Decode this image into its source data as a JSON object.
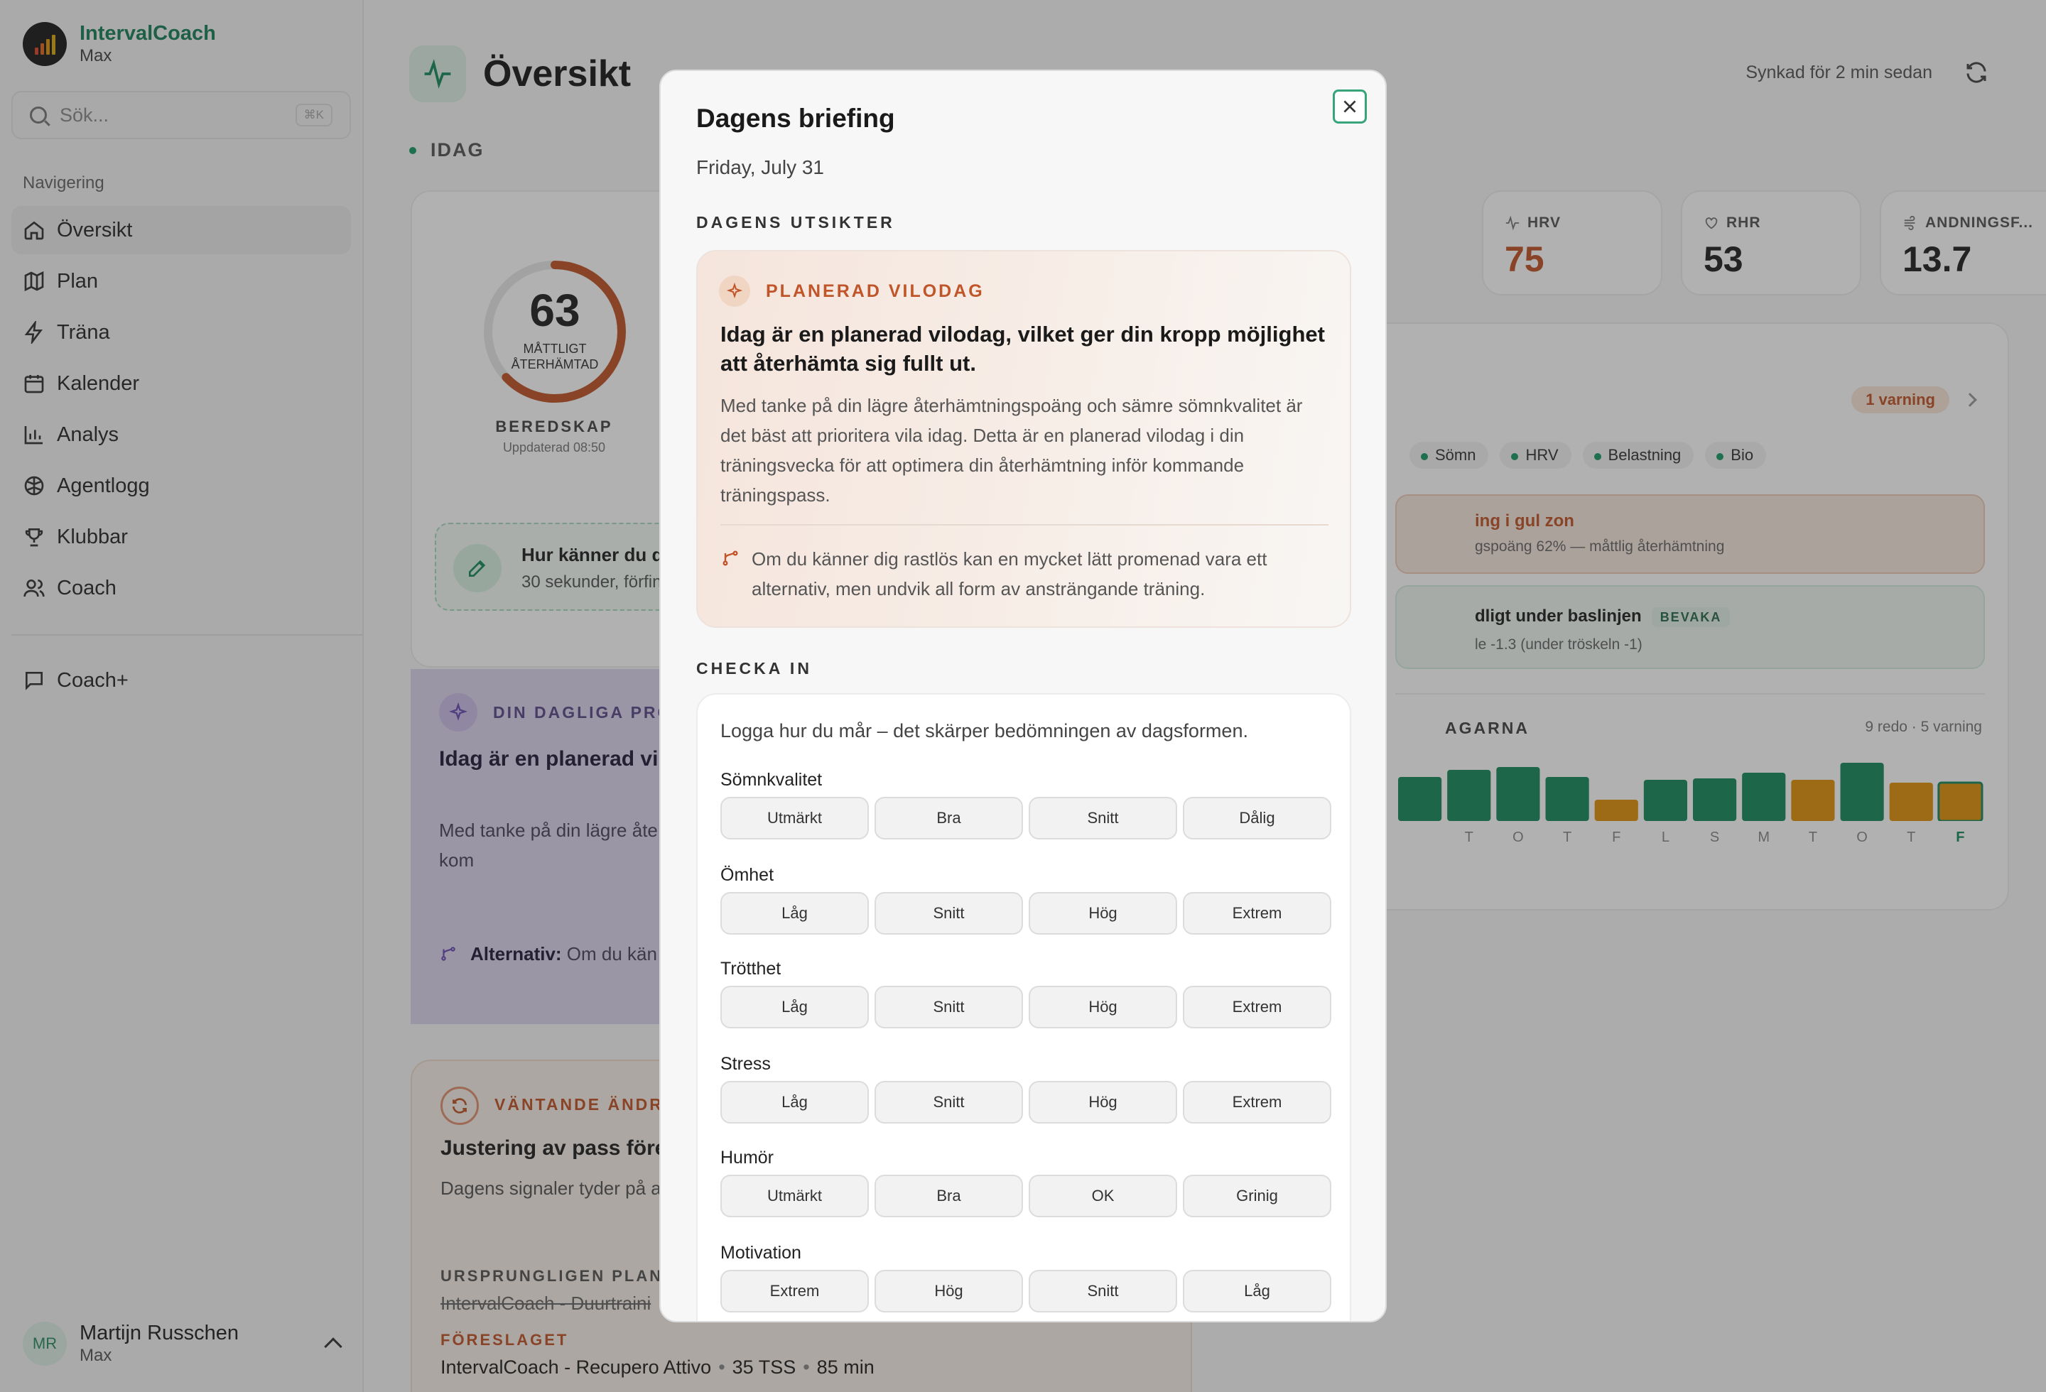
{
  "app": {
    "name": "IntervalCoach",
    "sub": "Max"
  },
  "search": {
    "placeholder": "Sök...",
    "shortcut": "⌘K"
  },
  "nav": {
    "heading": "Navigering",
    "items": [
      {
        "label": "Översikt",
        "icon": "home-icon"
      },
      {
        "label": "Plan",
        "icon": "map-icon"
      },
      {
        "label": "Träna",
        "icon": "lightning-icon"
      },
      {
        "label": "Kalender",
        "icon": "calendar-icon"
      },
      {
        "label": "Analys",
        "icon": "bar-chart-icon"
      },
      {
        "label": "Agentlogg",
        "icon": "brain-icon"
      },
      {
        "label": "Klubbar",
        "icon": "trophy-icon"
      },
      {
        "label": "Coach",
        "icon": "users-icon"
      }
    ],
    "coachplus": "Coach+"
  },
  "user": {
    "initials": "MR",
    "name": "Martijn Russchen",
    "sub": "Max"
  },
  "page": {
    "title": "Översikt",
    "synced": "Synkad för 2 min sedan",
    "today": "IDAG"
  },
  "readiness": {
    "score": "63",
    "score_value": 63,
    "state": "MÅTTLIGT ÅTERHÄMTAD",
    "title": "BEREDSKAP",
    "updated": "Uppdaterad 08:50",
    "feel_title": "Hur känner du d",
    "feel_sub": "30 sekunder, förfin"
  },
  "daily": {
    "label": "DIN DAGLIGA PRO",
    "title": "Idag är en planerad vi återhämta sig fullt ut.",
    "body": "Med tanke på din lägre åte prioritera vila idag. Detta ä din återhämtning inför kom",
    "alt_label": "Alternativ:",
    "alt_text": " Om du kän alternativ, men undvik"
  },
  "pending": {
    "label": "VÄNTANDE ÄNDRI",
    "title": "Justering av pass föres",
    "body": "Dagens signaler tyder på a eller behåll originalet.",
    "orig_label": "URSPRUNGLIGEN PLANER",
    "orig": "IntervalCoach - Duurtraini",
    "new_label": "FÖRESLAGET",
    "new_name": "IntervalCoach - Recupero Attivo",
    "new_tss": "35 TSS",
    "new_min": "85 min",
    "sep": "•"
  },
  "metrics": [
    {
      "label": "HRV",
      "value": "75",
      "color": "#c0552a",
      "icon": "pulse-icon"
    },
    {
      "label": "RHR",
      "value": "53",
      "color": "#222222",
      "icon": "heart-icon"
    },
    {
      "label": "ANDNINGSF...",
      "value": "13.7",
      "color": "#222222",
      "icon": "wind-icon"
    }
  ],
  "signals": {
    "warning": "1 varning",
    "chips": [
      "Sömn",
      "HRV",
      "Belastning",
      "Bio"
    ],
    "alert1_title": "ing i gul zon",
    "alert1_sub": "gspoäng 62% — måttlig återhämtning",
    "alert2_title": "dligt under baslinjen",
    "alert2_badge": "BEVAKA",
    "alert2_sub": "le -1.3 (under tröskeln -1)",
    "days_title": "AGARNA",
    "days_meta": "9 redo · 5 varning"
  },
  "day_bars": [
    {
      "day": "",
      "level": 0.62,
      "status": "green"
    },
    {
      "day": "T",
      "level": 0.72,
      "status": "green"
    },
    {
      "day": "O",
      "level": 0.76,
      "status": "green"
    },
    {
      "day": "T",
      "level": 0.62,
      "status": "green"
    },
    {
      "day": "F",
      "level": 0.3,
      "status": "orange"
    },
    {
      "day": "L",
      "level": 0.58,
      "status": "green"
    },
    {
      "day": "S",
      "level": 0.6,
      "status": "green"
    },
    {
      "day": "M",
      "level": 0.68,
      "status": "green"
    },
    {
      "day": "T",
      "level": 0.58,
      "status": "orange"
    },
    {
      "day": "O",
      "level": 0.82,
      "status": "green"
    },
    {
      "day": "T",
      "level": 0.54,
      "status": "orange"
    },
    {
      "day": "F",
      "level": 0.54,
      "status": "orange-today"
    }
  ],
  "colors": {
    "green": "#1a8a5e",
    "orange": "#e0910e",
    "accent": "#1a7f5a",
    "warn": "#c0552a"
  },
  "modal": {
    "title": "Dagens briefing",
    "date": "Friday, July 31",
    "prospect_section": "DAGENS UTSIKTER",
    "prospect_label": "PLANERAD VILODAG",
    "prospect_title": "Idag är en planerad vilodag, vilket ger din kropp möjlighet att återhämta sig fullt ut.",
    "prospect_body": "Med tanke på din lägre återhämtningspoäng och sämre sömnkvalitet är det bäst att prioritera vila idag. Detta är en planerad vilodag i din träningsvecka för att optimera din återhämtning inför kommande träningspass.",
    "prospect_tip": "Om du känner dig rastlös kan en mycket lätt promenad vara ett alternativ, men undvik all form av ansträngande träning.",
    "checkin_section": "CHECKA IN",
    "checkin_intro": "Logga hur du mår – det skärper bedömningen av dagsformen.",
    "questions": [
      {
        "label": "Sömnkvalitet",
        "options": [
          "Utmärkt",
          "Bra",
          "Snitt",
          "Dålig"
        ]
      },
      {
        "label": "Ömhet",
        "options": [
          "Låg",
          "Snitt",
          "Hög",
          "Extrem"
        ]
      },
      {
        "label": "Trötthet",
        "options": [
          "Låg",
          "Snitt",
          "Hög",
          "Extrem"
        ]
      },
      {
        "label": "Stress",
        "options": [
          "Låg",
          "Snitt",
          "Hög",
          "Extrem"
        ]
      },
      {
        "label": "Humör",
        "options": [
          "Utmärkt",
          "Bra",
          "OK",
          "Grinig"
        ]
      },
      {
        "label": "Motivation",
        "options": [
          "Extrem",
          "Hög",
          "Snitt",
          "Låg"
        ]
      }
    ]
  }
}
